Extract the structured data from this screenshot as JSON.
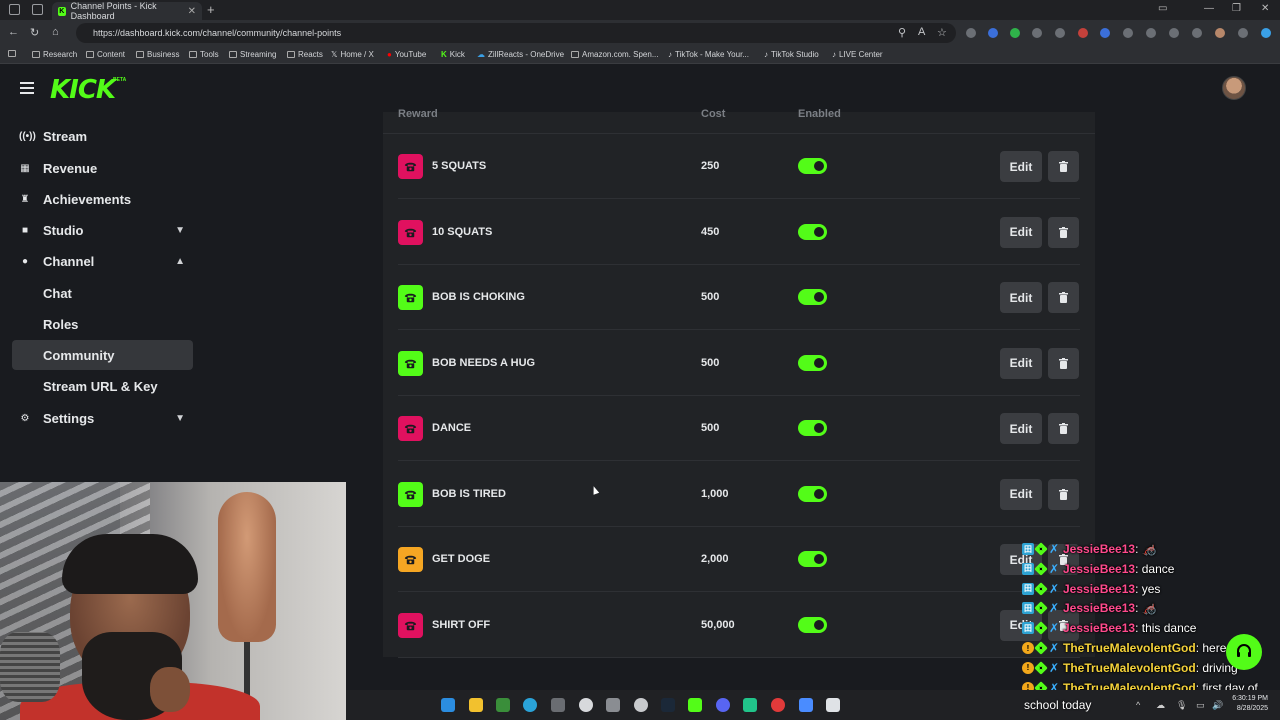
{
  "browser": {
    "tab_title": "Channel Points - Kick Dashboard",
    "tab_close": "✕",
    "new_tab": "+",
    "url": "https://dashboard.kick.com/channel/community/channel-points",
    "bookmarks": [
      "Research",
      "Content",
      "Business",
      "Tools",
      "Streaming",
      "Reacts",
      "Home / X",
      "YouTube",
      "Kick",
      "ZillReacts - OneDrive",
      "Amazon.com. Spen...",
      "TikTok - Make Your...",
      "TikTok Studio",
      "LIVE Center"
    ]
  },
  "header": {
    "logo": "KICK",
    "beta": "BETA",
    "accent_color": "#53fc18"
  },
  "sidebar": {
    "items": [
      {
        "label": "Stream",
        "icon": "broadcast-icon"
      },
      {
        "label": "Revenue",
        "icon": "chart-icon"
      },
      {
        "label": "Achievements",
        "icon": "trophy-icon"
      },
      {
        "label": "Studio",
        "icon": "video-icon",
        "chevron": "down"
      },
      {
        "label": "Channel",
        "icon": "user-icon",
        "chevron": "up"
      },
      {
        "label": "Chat"
      },
      {
        "label": "Roles"
      },
      {
        "label": "Community",
        "active": true
      },
      {
        "label": "Stream URL & Key"
      },
      {
        "label": "Settings",
        "icon": "gear-icon",
        "chevron": "down"
      }
    ]
  },
  "table": {
    "columns": [
      "Reward",
      "Cost",
      "Enabled"
    ],
    "edit_label": "Edit",
    "rows": [
      {
        "name": "5 SQUATS",
        "cost": "250",
        "color": "#e0115f",
        "enabled": true
      },
      {
        "name": "10 SQUATS",
        "cost": "450",
        "color": "#e0115f",
        "enabled": true
      },
      {
        "name": "BOB IS CHOKING",
        "cost": "500",
        "color": "#53fc18",
        "enabled": true
      },
      {
        "name": "BOB NEEDS A HUG",
        "cost": "500",
        "color": "#53fc18",
        "enabled": true
      },
      {
        "name": "DANCE",
        "cost": "500",
        "color": "#e0115f",
        "enabled": true
      },
      {
        "name": "BOB IS TIRED",
        "cost": "1,000",
        "color": "#53fc18",
        "enabled": true
      },
      {
        "name": "GET DOGE",
        "cost": "2,000",
        "color": "#f5a623",
        "enabled": true
      },
      {
        "name": "SHIRT OFF",
        "cost": "50,000",
        "color": "#e0115f",
        "enabled": true
      }
    ]
  },
  "chat": {
    "messages": [
      {
        "user": "JessieBee13",
        "text": ": 🦽",
        "color": "pink"
      },
      {
        "user": "JessieBee13",
        "text": ": dance",
        "color": "pink"
      },
      {
        "user": "JessieBee13",
        "text": ": yes",
        "color": "pink"
      },
      {
        "user": "JessieBee13",
        "text": ": 🦽",
        "color": "pink"
      },
      {
        "user": "JessieBee13",
        "text": ": this dance",
        "color": "pink"
      },
      {
        "user": "TheTrueMalevolentGod",
        "text": ": here",
        "color": "yellow"
      },
      {
        "user": "TheTrueMalevolentGod",
        "text": ": driving",
        "color": "yellow"
      },
      {
        "user": "TheTrueMalevolentGod",
        "text": ": first day of",
        "color": "yellow"
      }
    ],
    "continuation": "school today"
  },
  "taskbar": {
    "time": "6:30:19 PM",
    "date": "8/28/2025"
  }
}
